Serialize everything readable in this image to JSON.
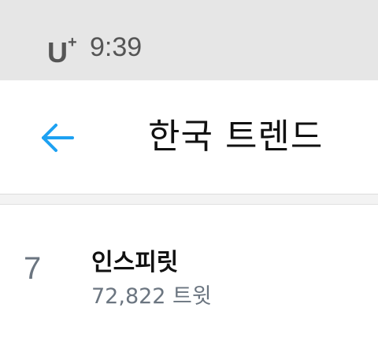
{
  "status_bar": {
    "carrier": "U",
    "carrier_plus": "+",
    "time": "9:39"
  },
  "toolbar": {
    "back_icon": "back-arrow-icon",
    "title": "한국 트렌드"
  },
  "colors": {
    "accent": "#1da1f2",
    "status_bar_bg": "#e6e6e6",
    "secondary_text": "#6b7580"
  },
  "trends": [
    {
      "rank": "7",
      "name": "인스피릿",
      "count": "72,822 트윗"
    }
  ]
}
